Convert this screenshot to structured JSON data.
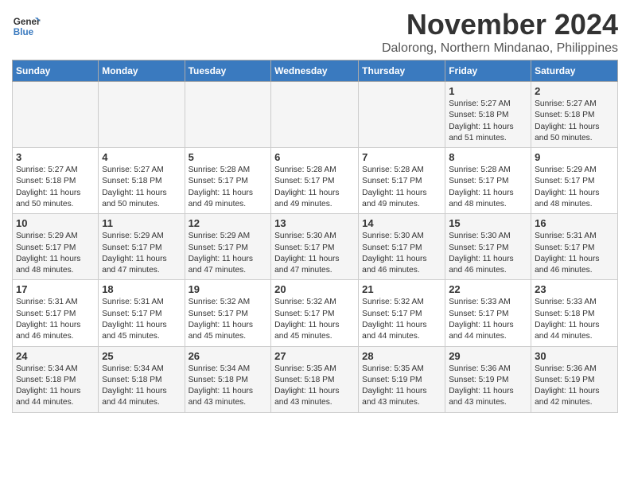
{
  "header": {
    "logo_line1": "General",
    "logo_line2": "Blue",
    "month_title": "November 2024",
    "location": "Dalorong, Northern Mindanao, Philippines"
  },
  "weekdays": [
    "Sunday",
    "Monday",
    "Tuesday",
    "Wednesday",
    "Thursday",
    "Friday",
    "Saturday"
  ],
  "weeks": [
    [
      {
        "day": "",
        "info": ""
      },
      {
        "day": "",
        "info": ""
      },
      {
        "day": "",
        "info": ""
      },
      {
        "day": "",
        "info": ""
      },
      {
        "day": "",
        "info": ""
      },
      {
        "day": "1",
        "info": "Sunrise: 5:27 AM\nSunset: 5:18 PM\nDaylight: 11 hours and 51 minutes."
      },
      {
        "day": "2",
        "info": "Sunrise: 5:27 AM\nSunset: 5:18 PM\nDaylight: 11 hours and 50 minutes."
      }
    ],
    [
      {
        "day": "3",
        "info": "Sunrise: 5:27 AM\nSunset: 5:18 PM\nDaylight: 11 hours and 50 minutes."
      },
      {
        "day": "4",
        "info": "Sunrise: 5:27 AM\nSunset: 5:18 PM\nDaylight: 11 hours and 50 minutes."
      },
      {
        "day": "5",
        "info": "Sunrise: 5:28 AM\nSunset: 5:17 PM\nDaylight: 11 hours and 49 minutes."
      },
      {
        "day": "6",
        "info": "Sunrise: 5:28 AM\nSunset: 5:17 PM\nDaylight: 11 hours and 49 minutes."
      },
      {
        "day": "7",
        "info": "Sunrise: 5:28 AM\nSunset: 5:17 PM\nDaylight: 11 hours and 49 minutes."
      },
      {
        "day": "8",
        "info": "Sunrise: 5:28 AM\nSunset: 5:17 PM\nDaylight: 11 hours and 48 minutes."
      },
      {
        "day": "9",
        "info": "Sunrise: 5:29 AM\nSunset: 5:17 PM\nDaylight: 11 hours and 48 minutes."
      }
    ],
    [
      {
        "day": "10",
        "info": "Sunrise: 5:29 AM\nSunset: 5:17 PM\nDaylight: 11 hours and 48 minutes."
      },
      {
        "day": "11",
        "info": "Sunrise: 5:29 AM\nSunset: 5:17 PM\nDaylight: 11 hours and 47 minutes."
      },
      {
        "day": "12",
        "info": "Sunrise: 5:29 AM\nSunset: 5:17 PM\nDaylight: 11 hours and 47 minutes."
      },
      {
        "day": "13",
        "info": "Sunrise: 5:30 AM\nSunset: 5:17 PM\nDaylight: 11 hours and 47 minutes."
      },
      {
        "day": "14",
        "info": "Sunrise: 5:30 AM\nSunset: 5:17 PM\nDaylight: 11 hours and 46 minutes."
      },
      {
        "day": "15",
        "info": "Sunrise: 5:30 AM\nSunset: 5:17 PM\nDaylight: 11 hours and 46 minutes."
      },
      {
        "day": "16",
        "info": "Sunrise: 5:31 AM\nSunset: 5:17 PM\nDaylight: 11 hours and 46 minutes."
      }
    ],
    [
      {
        "day": "17",
        "info": "Sunrise: 5:31 AM\nSunset: 5:17 PM\nDaylight: 11 hours and 46 minutes."
      },
      {
        "day": "18",
        "info": "Sunrise: 5:31 AM\nSunset: 5:17 PM\nDaylight: 11 hours and 45 minutes."
      },
      {
        "day": "19",
        "info": "Sunrise: 5:32 AM\nSunset: 5:17 PM\nDaylight: 11 hours and 45 minutes."
      },
      {
        "day": "20",
        "info": "Sunrise: 5:32 AM\nSunset: 5:17 PM\nDaylight: 11 hours and 45 minutes."
      },
      {
        "day": "21",
        "info": "Sunrise: 5:32 AM\nSunset: 5:17 PM\nDaylight: 11 hours and 44 minutes."
      },
      {
        "day": "22",
        "info": "Sunrise: 5:33 AM\nSunset: 5:17 PM\nDaylight: 11 hours and 44 minutes."
      },
      {
        "day": "23",
        "info": "Sunrise: 5:33 AM\nSunset: 5:18 PM\nDaylight: 11 hours and 44 minutes."
      }
    ],
    [
      {
        "day": "24",
        "info": "Sunrise: 5:34 AM\nSunset: 5:18 PM\nDaylight: 11 hours and 44 minutes."
      },
      {
        "day": "25",
        "info": "Sunrise: 5:34 AM\nSunset: 5:18 PM\nDaylight: 11 hours and 44 minutes."
      },
      {
        "day": "26",
        "info": "Sunrise: 5:34 AM\nSunset: 5:18 PM\nDaylight: 11 hours and 43 minutes."
      },
      {
        "day": "27",
        "info": "Sunrise: 5:35 AM\nSunset: 5:18 PM\nDaylight: 11 hours and 43 minutes."
      },
      {
        "day": "28",
        "info": "Sunrise: 5:35 AM\nSunset: 5:19 PM\nDaylight: 11 hours and 43 minutes."
      },
      {
        "day": "29",
        "info": "Sunrise: 5:36 AM\nSunset: 5:19 PM\nDaylight: 11 hours and 43 minutes."
      },
      {
        "day": "30",
        "info": "Sunrise: 5:36 AM\nSunset: 5:19 PM\nDaylight: 11 hours and 42 minutes."
      }
    ]
  ]
}
